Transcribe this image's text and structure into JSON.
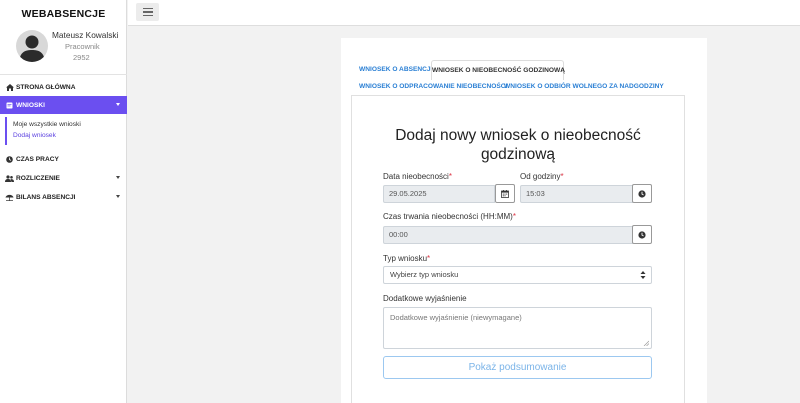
{
  "app": {
    "title": "WEBABSENCJE"
  },
  "user": {
    "name": "Mateusz Kowalski",
    "role": "Pracownik",
    "id": "2952"
  },
  "sidebar": {
    "items": [
      {
        "label": "STRONA GŁÓWNA",
        "icon": "home-icon"
      },
      {
        "label": "WNIOSKI",
        "icon": "document-icon"
      },
      {
        "label": "CZAS PRACY",
        "icon": "clock-icon"
      },
      {
        "label": "ROZLICZENIE",
        "icon": "users-icon"
      },
      {
        "label": "BILANS ABSENCJI",
        "icon": "beach-umbrella-icon"
      }
    ],
    "subitems": [
      {
        "label": "Moje wszystkie wnioski"
      },
      {
        "label": "Dodaj wniosek"
      }
    ]
  },
  "tabs": [
    {
      "label": "WNIOSEK O ABSENCJE"
    },
    {
      "label": "WNIOSEK O NIEOBECNOŚĆ GODZINOWĄ"
    },
    {
      "label": "WNIOSEK O ODPRACOWANIE NIEOBECNOŚCI"
    },
    {
      "label": "WNIOSEK O ODBIÓR WOLNEGO ZA NADGODZINY"
    }
  ],
  "form": {
    "title_line1": "Dodaj nowy wniosek o nieobecność",
    "title_line2": "godzinową",
    "date_label": "Data nieobecności",
    "date_value": "29.05.2025",
    "from_label": "Od godziny",
    "from_value": "15:03",
    "duration_label": "Czas trwania nieobecności (HH:MM)",
    "duration_value": "00:00",
    "type_label": "Typ wniosku",
    "type_value": "Wybierz typ wniosku",
    "notes_label": "Dodatkowe wyjaśnienie",
    "notes_placeholder": "Dodatkowe wyjaśnienie (niewymagane)",
    "required_mark": "*",
    "summary_button": "Pokaż podsumowanie"
  },
  "colors": {
    "accent": "#6b4ff0",
    "link": "#2a7fd4",
    "required": "#dc3545"
  }
}
